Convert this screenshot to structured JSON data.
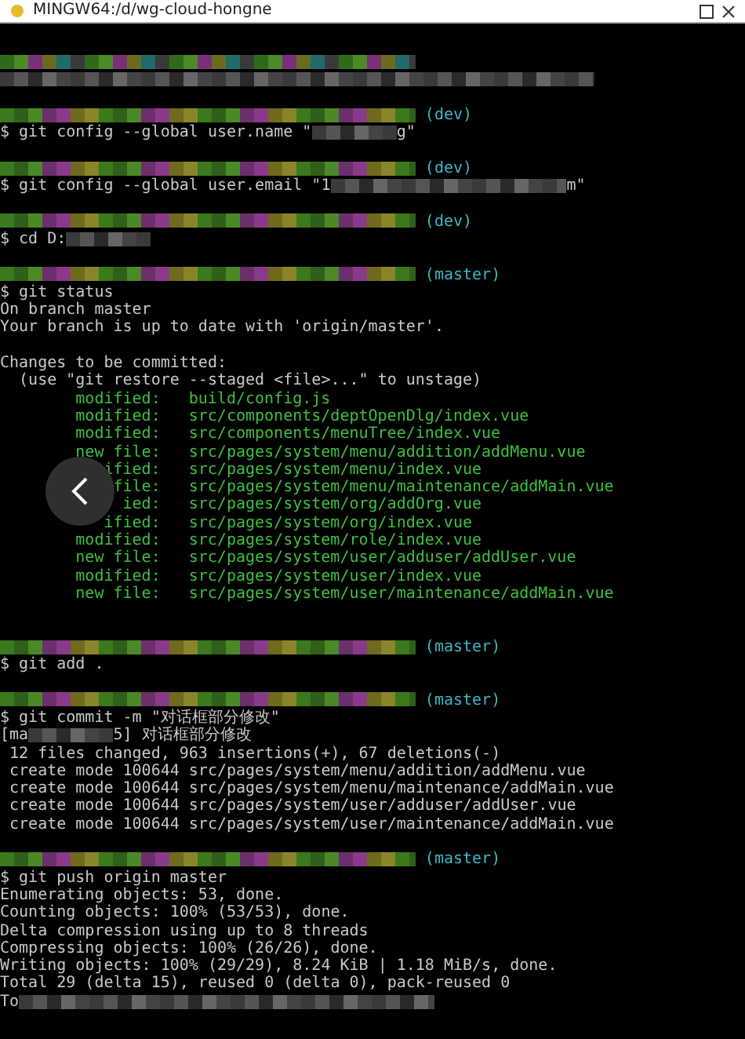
{
  "window": {
    "title": "MINGW64:/d/wg-cloud-hongne"
  },
  "terminal": {
    "lines": [
      {
        "kind": "mosaic-color",
        "mosaic": {
          "kind": "long"
        }
      },
      {
        "kind": "mosaic-grey",
        "mosaic": {
          "kind": "full"
        }
      },
      {
        "kind": "blank"
      },
      {
        "kind": "prompt",
        "mosaic": {
          "kind": "long"
        },
        "branch": "(dev)"
      },
      {
        "kind": "command",
        "text": "$ git config --global user.name \"",
        "mosaic": {
          "kind": "short"
        },
        "tail": "g\""
      },
      {
        "kind": "blank"
      },
      {
        "kind": "prompt",
        "mosaic": {
          "kind": "long"
        },
        "branch": "(dev)"
      },
      {
        "kind": "command",
        "text": "$ git config --global user.email \"1",
        "mosaic": {
          "kind": "medium"
        },
        "tail": "m\""
      },
      {
        "kind": "blank"
      },
      {
        "kind": "prompt",
        "mosaic": {
          "kind": "long"
        },
        "branch": "(dev)"
      },
      {
        "kind": "command",
        "text": "$ cd D:",
        "mosaic": {
          "kind": "short"
        }
      },
      {
        "kind": "blank"
      },
      {
        "kind": "prompt",
        "mosaic": {
          "kind": "long"
        },
        "branch": "(master)"
      },
      {
        "kind": "command",
        "text": "$ git status"
      },
      {
        "kind": "output",
        "text": "On branch master"
      },
      {
        "kind": "output",
        "text": "Your branch is up to date with 'origin/master'."
      },
      {
        "kind": "blank"
      },
      {
        "kind": "output",
        "text": "Changes to be committed:"
      },
      {
        "kind": "output",
        "text": "  (use \"git restore --staged <file>...\" to unstage)"
      },
      {
        "kind": "staged",
        "status": "modified:",
        "path": "build/config.js"
      },
      {
        "kind": "staged",
        "status": "modified:",
        "path": "src/components/deptOpenDlg/index.vue"
      },
      {
        "kind": "staged",
        "status": "modified:",
        "path": "src/components/menuTree/index.vue"
      },
      {
        "kind": "staged",
        "status": "new file:",
        "path": "src/pages/system/menu/addition/addMenu.vue"
      },
      {
        "kind": "staged",
        "status": "ified:",
        "path": "src/pages/system/menu/index.vue"
      },
      {
        "kind": "staged",
        "status": "file:",
        "path": "src/pages/system/menu/maintenance/addMain.vue"
      },
      {
        "kind": "staged",
        "status": "ied:",
        "path": "src/pages/system/org/addOrg.vue"
      },
      {
        "kind": "staged",
        "status": "ified:",
        "path": "src/pages/system/org/index.vue"
      },
      {
        "kind": "staged",
        "status": "modified:",
        "path": "src/pages/system/role/index.vue"
      },
      {
        "kind": "staged",
        "status": "new file:",
        "path": "src/pages/system/user/adduser/addUser.vue"
      },
      {
        "kind": "staged",
        "status": "modified:",
        "path": "src/pages/system/user/index.vue"
      },
      {
        "kind": "staged",
        "status": "new file:",
        "path": "src/pages/system/user/maintenance/addMain.vue"
      },
      {
        "kind": "blank"
      },
      {
        "kind": "blank"
      },
      {
        "kind": "prompt",
        "mosaic": {
          "kind": "long"
        },
        "branch": "(master)"
      },
      {
        "kind": "command",
        "text": "$ git add ."
      },
      {
        "kind": "blank"
      },
      {
        "kind": "prompt",
        "mosaic": {
          "kind": "long"
        },
        "branch": "(master)"
      },
      {
        "kind": "command",
        "text": "$ git commit -m \"对话框部分修改\""
      },
      {
        "kind": "output",
        "text": "[ma",
        "mosaic": {
          "kind": "short"
        },
        "tail": "5] 对话框部分修改"
      },
      {
        "kind": "output",
        "text": " 12 files changed, 963 insertions(+), 67 deletions(-)"
      },
      {
        "kind": "output",
        "text": " create mode 100644 src/pages/system/menu/addition/addMenu.vue"
      },
      {
        "kind": "output",
        "text": " create mode 100644 src/pages/system/menu/maintenance/addMain.vue"
      },
      {
        "kind": "output",
        "text": " create mode 100644 src/pages/system/user/adduser/addUser.vue"
      },
      {
        "kind": "output",
        "text": " create mode 100644 src/pages/system/user/maintenance/addMain.vue"
      },
      {
        "kind": "blank"
      },
      {
        "kind": "prompt",
        "mosaic": {
          "kind": "long"
        },
        "branch": "(master)"
      },
      {
        "kind": "command",
        "text": "$ git push origin master"
      },
      {
        "kind": "output",
        "text": "Enumerating objects: 53, done."
      },
      {
        "kind": "output",
        "text": "Counting objects: 100% (53/53), done."
      },
      {
        "kind": "output",
        "text": "Delta compression using up to 8 threads"
      },
      {
        "kind": "output",
        "text": "Compressing objects: 100% (26/26), done."
      },
      {
        "kind": "output",
        "text": "Writing objects: 100% (29/29), 8.24 KiB | 1.18 MiB/s, done."
      },
      {
        "kind": "output",
        "text": "Total 29 (delta 15), reused 0 (delta 0), pack-reused 0"
      },
      {
        "kind": "output",
        "text": "To",
        "mosaic": {
          "kind": "long"
        }
      }
    ]
  }
}
